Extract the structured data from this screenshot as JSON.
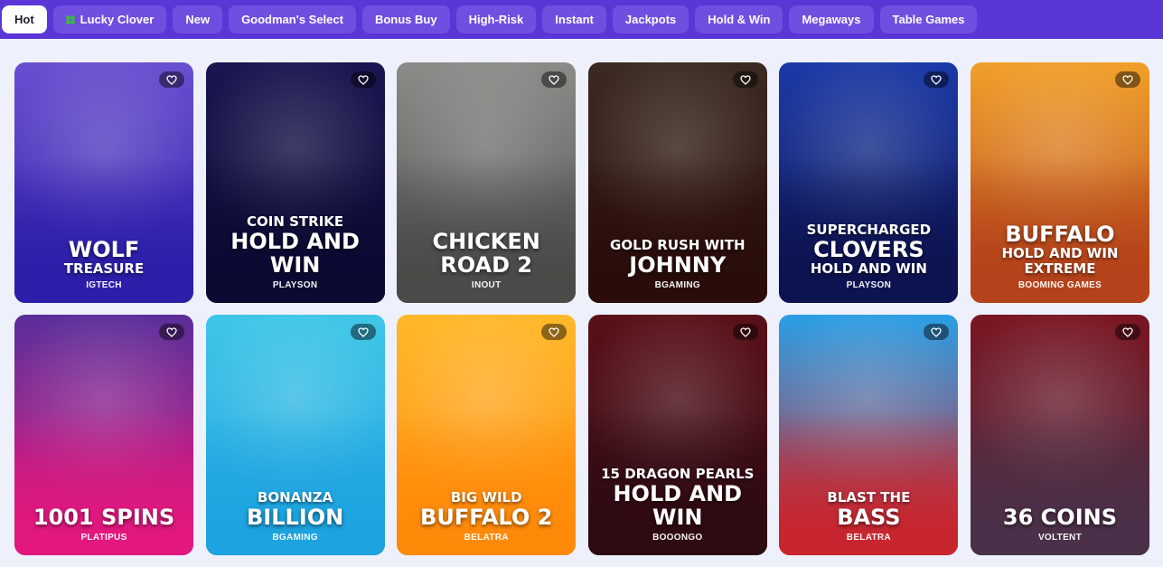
{
  "tabs": [
    {
      "label": "Hot",
      "active": true
    },
    {
      "label": "Lucky Clover",
      "icon": "clover-icon"
    },
    {
      "label": "New"
    },
    {
      "label": "Goodman's Select"
    },
    {
      "label": "Bonus Buy"
    },
    {
      "label": "High-Risk"
    },
    {
      "label": "Instant"
    },
    {
      "label": "Jackpots"
    },
    {
      "label": "Hold & Win"
    },
    {
      "label": "Megaways"
    },
    {
      "label": "Table Games"
    }
  ],
  "games": [
    {
      "id": "wolf-treasure",
      "title_lines": [
        "WOLF",
        "TREASURE"
      ],
      "title_styles": [
        "big",
        "small"
      ],
      "provider": "IGTECH",
      "colors": [
        "#6a4fd0",
        "#2c1ea8"
      ]
    },
    {
      "id": "coin-strike",
      "title_lines": [
        "COIN STRIKE",
        "HOLD AND",
        "WIN"
      ],
      "title_styles": [
        "small",
        "big",
        "big"
      ],
      "provider": "PLAYSON",
      "colors": [
        "#1a1650",
        "#0b0a33"
      ]
    },
    {
      "id": "chicken-road-2",
      "title_lines": [
        "CHICKEN",
        "ROAD 2"
      ],
      "title_styles": [
        "big",
        "big"
      ],
      "provider": "INOUT",
      "colors": [
        "#8a8c88",
        "#4a4b48"
      ]
    },
    {
      "id": "gold-rush-johnny",
      "title_lines": [
        "GOLD RUSH WITH",
        "JOHNNY"
      ],
      "title_styles": [
        "small",
        "big"
      ],
      "provider": "BGAMING",
      "colors": [
        "#3b2a22",
        "#2a0d0a"
      ]
    },
    {
      "id": "supercharged-clovers",
      "title_lines": [
        "SUPERCHARGED",
        "CLOVERS",
        "HOLD AND WIN"
      ],
      "title_styles": [
        "small",
        "big",
        "small"
      ],
      "provider": "PLAYSON",
      "colors": [
        "#1b3aa8",
        "#0d1350"
      ]
    },
    {
      "id": "buffalo-extreme",
      "title_lines": [
        "BUFFALO",
        "HOLD AND WIN",
        "EXTREME"
      ],
      "title_styles": [
        "big",
        "small",
        "small"
      ],
      "provider": "BOOMING GAMES",
      "colors": [
        "#f0a02a",
        "#b4421a"
      ]
    },
    {
      "id": "1001-spins",
      "title_lines": [
        "1001 SPINS"
      ],
      "title_styles": [
        "big"
      ],
      "provider": "PLATIPUS",
      "colors": [
        "#5a2e9a",
        "#e2187e"
      ]
    },
    {
      "id": "bonanza-billion",
      "title_lines": [
        "BONANZA",
        "BILLION"
      ],
      "title_styles": [
        "small",
        "big"
      ],
      "provider": "BGAMING",
      "colors": [
        "#3fc6e8",
        "#1da3df"
      ]
    },
    {
      "id": "big-wild-buffalo-2",
      "title_lines": [
        "BIG WILD",
        "BUFFALO 2"
      ],
      "title_styles": [
        "small",
        "big"
      ],
      "provider": "BELATRA",
      "colors": [
        "#ffb82a",
        "#ff8a0a"
      ]
    },
    {
      "id": "15-dragon-pearls",
      "title_lines": [
        "15 DRAGON PEARLS",
        "HOLD AND",
        "WIN"
      ],
      "title_styles": [
        "small",
        "big",
        "big"
      ],
      "provider": "BOOONGO",
      "colors": [
        "#5a1018",
        "#2e0a12"
      ]
    },
    {
      "id": "blast-the-bass",
      "title_lines": [
        "BLAST THE",
        "BASS"
      ],
      "title_styles": [
        "small",
        "big"
      ],
      "provider": "BELATRA",
      "colors": [
        "#2a9fe6",
        "#c8262e"
      ]
    },
    {
      "id": "36-coins",
      "title_lines": [
        "36 COINS"
      ],
      "title_styles": [
        "big"
      ],
      "provider": "VOLTENT",
      "colors": [
        "#7a1622",
        "#4a3048"
      ]
    }
  ]
}
